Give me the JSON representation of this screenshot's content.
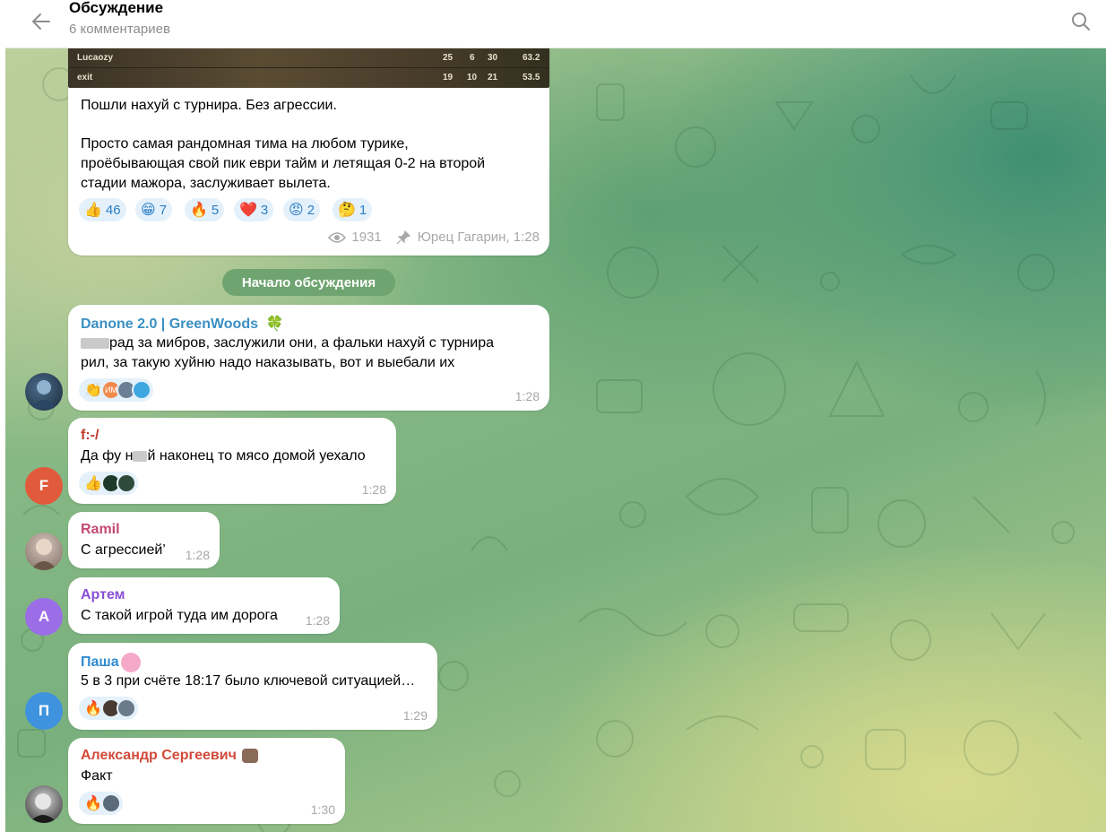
{
  "header": {
    "title": "Обсуждение",
    "subtitle": "6 комментариев"
  },
  "post": {
    "stats_rows": [
      {
        "name": "Lucaozy",
        "k": "25",
        "a": "6",
        "d": "30",
        "rating": "63.2"
      },
      {
        "name": "exit",
        "k": "19",
        "a": "10",
        "d": "21",
        "rating": "53.5"
      }
    ],
    "text_line1": "Пошли нахуй с турнира. Без агрессии.",
    "text_line2": "Просто самая рандомная тима на любом турике,",
    "text_line3": "проёбывающая свой пик еври тайм и летящая 0-2 на второй",
    "text_line4": "стадии мажора, заслуживает вылета.",
    "reactions": [
      {
        "emoji": "👍",
        "count": "46"
      },
      {
        "emoji": "😁",
        "count": "7"
      },
      {
        "emoji": "🔥",
        "count": "5"
      },
      {
        "emoji": "❤️",
        "count": "3"
      },
      {
        "emoji": "😡",
        "count": "2"
      },
      {
        "emoji": "🤔",
        "count": "1"
      }
    ],
    "views": "1931",
    "author_time": "Юрец Гагарин, 1:28"
  },
  "divider": "Начало обсуждения",
  "comments": [
    {
      "author": "Danone 2.0 | GreenWoods",
      "author_emoji": "🍀",
      "author_color": "#3a8fc2",
      "line1": "рад за мибров, заслужили они, а фальки нахуй с турнира",
      "line2": "рил, за такую хуйню надо наказывать, вот и выебали их",
      "reaction": "👏",
      "mini_label": "ИМ",
      "time": "1:28"
    },
    {
      "author": "f:-/",
      "author_color": "#c0392b",
      "avatar_letter": "F",
      "line1_a": "Да фу н",
      "line1_b": "й наконец то мясо домой уехало",
      "reaction": "👍",
      "time": "1:28"
    },
    {
      "author": "Ramil",
      "author_color": "#c2496e",
      "line1": "С агрессией’",
      "time": "1:28"
    },
    {
      "author": "Артем",
      "author_color": "#8a4fd6",
      "avatar_letter": "А",
      "line1": "С такой игрой туда им дорога",
      "time": "1:28"
    },
    {
      "author": "Паша",
      "author_color": "#2f8ccf",
      "avatar_letter": "П",
      "line1": "5 в 3 при счёте 18:17 было ключевой ситуацией…",
      "reaction": "🔥",
      "time": "1:29"
    },
    {
      "author": "Александр Сергеевич",
      "author_color": "#d24a3a",
      "line1": "Факт",
      "reaction": "🔥",
      "time": "1:30"
    }
  ],
  "colors": {
    "accent": "#2c7fc6",
    "divider_bg": "#6fa470",
    "reaction_bg": "#e4f1fb"
  }
}
